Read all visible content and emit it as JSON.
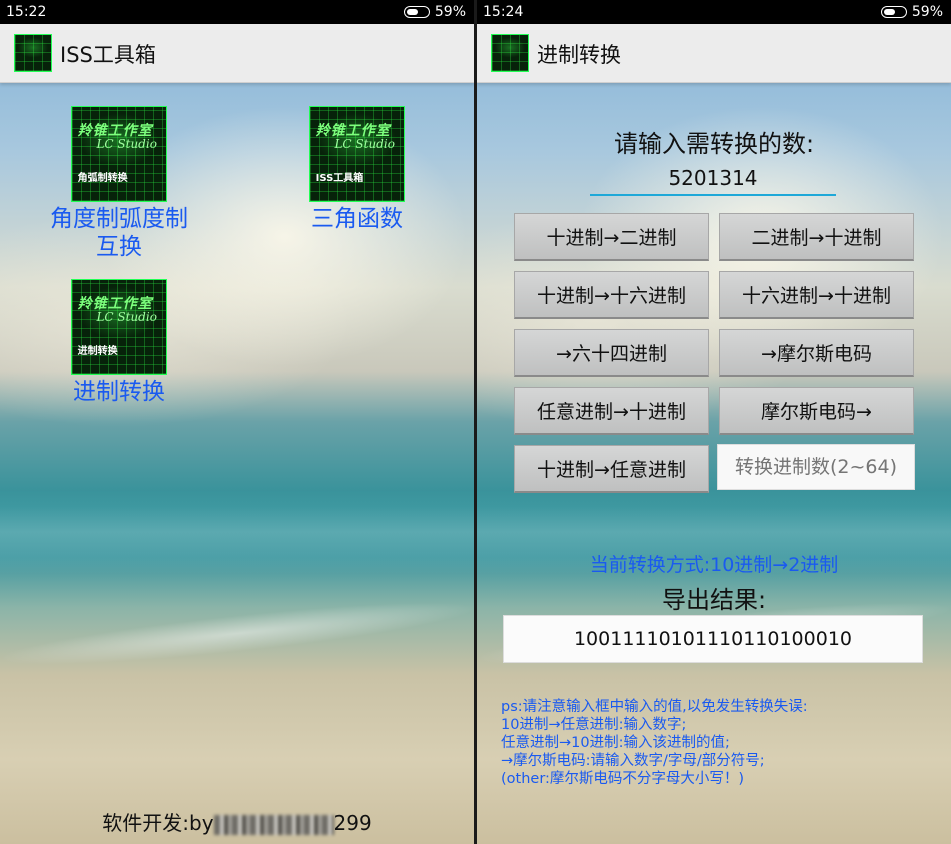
{
  "left": {
    "status": {
      "time": "15:22",
      "battery": "59%",
      "battery_level": 0.59
    },
    "appbar": {
      "title": "ISS工具箱",
      "logo_text": "羚锥工作室"
    },
    "items": [
      {
        "label": "角度制弧度制\n互换",
        "icon_caption": "羚锥工作室",
        "icon_sub": "LC Studio",
        "icon_label": "角弧制转换"
      },
      {
        "label": "三角函数",
        "icon_caption": "羚锥工作室",
        "icon_sub": "LC Studio",
        "icon_label": "ISS工具箱"
      },
      {
        "label": "进制转换",
        "icon_caption": "羚锥工作室",
        "icon_sub": "LC Studio",
        "icon_label": "进制转换"
      }
    ],
    "footer": {
      "prefix": "软件开发:by",
      "suffix": "299"
    }
  },
  "right": {
    "status": {
      "time": "15:24",
      "battery": "59%",
      "battery_level": 0.59
    },
    "appbar": {
      "title": "进制转换",
      "logo_text": "羚锥工作室"
    },
    "prompt": "请输入需转换的数:",
    "input_value": "5201314",
    "buttons": [
      "十进制→二进制",
      "二进制→十进制",
      "十进制→十六进制",
      "十六进制→十进制",
      "→六十四进制",
      "→摩尔斯电码",
      "任意进制→十进制",
      "摩尔斯电码→",
      "十进制→任意进制"
    ],
    "radix_placeholder": "转换进制数(2~64)",
    "mode_text": "当前转换方式:10进制→2进制",
    "result_label": "导出结果:",
    "result_value": "1001111010111011010001 0",
    "notes": [
      "ps:请注意输入框中输入的值,以免发生转换失误:",
      "10进制→任意进制:输入数字;",
      "任意进制→10进制:输入该进制的值;",
      "→摩尔斯电码:请输入数字/字母/部分符号;",
      "(other:摩尔斯电码不分字母大小写！)"
    ]
  }
}
